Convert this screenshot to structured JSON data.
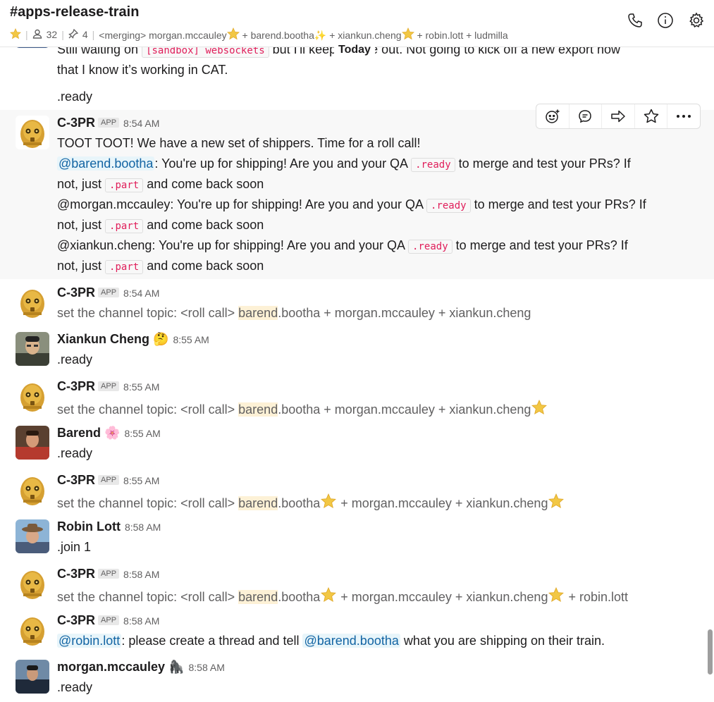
{
  "header": {
    "channel": "#apps-release-train",
    "member_count": "32",
    "pinned_count": "4",
    "topic": "<merging> morgan.mccauley",
    "topic_2": "+ barend.bootha",
    "topic_3": "+ xiankun.cheng",
    "topic_4": "+ robin.lott + ludmilla",
    "icons": [
      "star-icon",
      "members-icon",
      "pin-icon",
      "phone-icon",
      "info-icon",
      "gear-icon"
    ]
  },
  "divider": {
    "label": "Today"
  },
  "prev": {
    "line1a": "Still waiting on ",
    "code1": "[sandbox] websockets",
    "line1b": " but I'll keep an eye out. Not going to kick off a new export now",
    "line2": "that I know it’s working in CAT.",
    "line3": ".ready"
  },
  "toolbar": {
    "icons": [
      "add-reaction-icon",
      "reply-thread-icon",
      "share-icon",
      "save-icon",
      "more-icon"
    ]
  },
  "msgs": {
    "m1": {
      "name": "C-3PR",
      "badge": "APP",
      "time": "8:54 AM",
      "l1": "TOOT TOOT! We have a new set of shippers. Time for a roll call!",
      "m_barend": "@barend.bootha",
      "l2a": ": You're up for shipping! Are you and your QA ",
      "ready": ".ready",
      "l2b": " to merge and test your PRs? If",
      "l3a": "not, just ",
      "part": ".part",
      "l3b": " and come back soon",
      "l4a": "@morgan.mccauley: You're up for shipping! Are you and your QA ",
      "l4b": " to merge and test your PRs? If",
      "l6a": "@xiankun.cheng: You're up for shipping! Are you and your QA ",
      "l6b": " to merge and test your PRs? If"
    },
    "m2": {
      "name": "C-3PR",
      "badge": "APP",
      "time": "8:54 AM",
      "pre": "set the channel topic: <roll call> ",
      "hl": "barend",
      "post": ".bootha + morgan.mccauley + xiankun.cheng"
    },
    "m3": {
      "name": "Xiankun Cheng",
      "status": "🤔",
      "time": "8:55 AM",
      "text": ".ready"
    },
    "m4": {
      "name": "C-3PR",
      "badge": "APP",
      "time": "8:55 AM",
      "pre": "set the channel topic: <roll call> ",
      "hl": "barend",
      "post": ".bootha + morgan.mccauley + xiankun.cheng"
    },
    "m5": {
      "name": "Barend",
      "status": "🌸",
      "time": "8:55 AM",
      "text": ".ready"
    },
    "m6": {
      "name": "C-3PR",
      "badge": "APP",
      "time": "8:55 AM",
      "pre": "set the channel topic: <roll call> ",
      "hl": "barend",
      "a": ".bootha",
      "b": " + morgan.mccauley + xiankun.cheng"
    },
    "m7": {
      "name": "Robin Lott",
      "time": "8:58 AM",
      "text": ".join 1"
    },
    "m8": {
      "name": "C-3PR",
      "badge": "APP",
      "time": "8:58 AM",
      "pre": "set the channel topic: <roll call> ",
      "hl": "barend",
      "a": ".bootha",
      "b": " + morgan.mccauley + xiankun.cheng",
      "c": " + robin.lott"
    },
    "m9": {
      "name": "C-3PR",
      "badge": "APP",
      "time": "8:58 AM",
      "m_robin": "@robin.lott",
      "t1": ": please create a thread and tell ",
      "m_barend": "@barend.bootha",
      "t2": " what you are shipping on their train."
    },
    "m10": {
      "name": "morgan.mccauley",
      "status": "🦍",
      "time": "8:58 AM",
      "text": ".ready"
    }
  },
  "colors": {
    "mention": "#1264a3",
    "code": "#e01e5a",
    "highlight": "#fdf1d6",
    "star": "#f2c744"
  }
}
